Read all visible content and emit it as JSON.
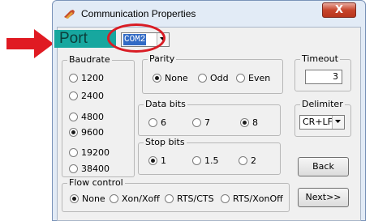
{
  "window": {
    "title": "Communication Properties",
    "close_label": "X"
  },
  "port": {
    "label": "Port",
    "selected": "COM2"
  },
  "baudrate": {
    "title": "Baudrate",
    "options": [
      "1200",
      "2400",
      "4800",
      "9600",
      "19200",
      "38400"
    ],
    "selected": "9600"
  },
  "parity": {
    "title": "Parity",
    "options": [
      "None",
      "Odd",
      "Even"
    ],
    "selected": "None"
  },
  "data_bits": {
    "title": "Data bits",
    "options": [
      "6",
      "7",
      "8"
    ],
    "selected": "8"
  },
  "stop_bits": {
    "title": "Stop bits",
    "options": [
      "1",
      "1.5",
      "2"
    ],
    "selected": "1"
  },
  "timeout": {
    "title": "Timeout",
    "value": "3"
  },
  "delimiter": {
    "title": "Delimiter",
    "selected": "CR+LF"
  },
  "flow_control": {
    "title": "Flow control",
    "options": [
      "None",
      "Xon/Xoff",
      "RTS/CTS",
      "RTS/XonOff"
    ],
    "selected": "None"
  },
  "buttons": {
    "back": "Back",
    "next": "Next>>"
  },
  "colors": {
    "annotation": "#d91c24",
    "port_highlight": "#17a79f",
    "selection": "#316ac5"
  },
  "icons": {
    "title": "app-icon",
    "annotation_arrow": "arrow-right-icon",
    "dropdown": "chevron-down-icon"
  }
}
